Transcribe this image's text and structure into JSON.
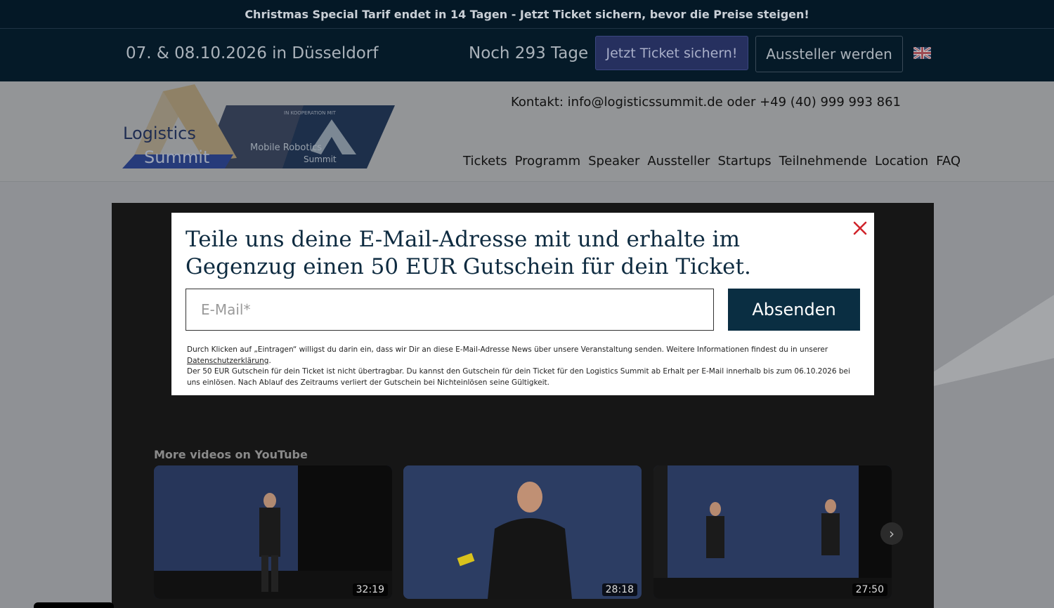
{
  "promo": {
    "text": "Christmas Special Tarif endet in 14 Tagen - Jetzt Ticket sichern, bevor die Preise steigen!"
  },
  "infobar": {
    "date": "07. & 08.10.2026 in Düsseldorf",
    "countdown": "Noch 293 Tage",
    "ticket_button": "Jetzt Ticket sichern!",
    "exhibitor_button": "Aussteller werden",
    "language_icon": "uk-flag-icon"
  },
  "header": {
    "logo": {
      "primary_line1": "Logistics",
      "primary_line2": "Summit",
      "cooperation": "IN KOOPERATION MIT",
      "partner_line1": "Mobile Robotics",
      "partner_line2": "Summit"
    },
    "contact": "Kontakt: info@logisticssummit.de oder +49 (40) 999 993 861",
    "nav": [
      "Tickets",
      "Programm",
      "Speaker",
      "Aussteller",
      "Startups",
      "Teilnehmende",
      "Location",
      "FAQ"
    ]
  },
  "video": {
    "more_label": "More videos on YouTube",
    "thumbnails": [
      {
        "duration": "32:19"
      },
      {
        "duration": "28:18"
      },
      {
        "duration": "27:50"
      }
    ],
    "next_icon": "chevron-right-icon"
  },
  "modal": {
    "title": "Teile uns deine E-Mail-Adresse mit und erhalte im Gegenzug einen 50 EUR Gutschein für dein Ticket.",
    "email_placeholder": "E-Mail*",
    "submit_label": "Absenden",
    "legal_part1": "Durch Klicken auf „Eintragen“ willigst du darin ein, dass wir Dir an diese E-Mail-Adresse News über unsere Veranstaltung senden. Weitere Informationen findest du in unserer ",
    "privacy_link": "Datenschutzerklärung",
    "legal_part2": ".",
    "legal_part3": "Der 50 EUR Gutschein für dein Ticket ist nicht übertragbar. Du kannst den Gutschein für dein Ticket für den Logistics Summit ab Erhalt per E-Mail innerhalb bis zum 06.10.2026 bei uns einlösen. Nach Ablauf des Zeitraums verliert der Gutschein bei Nichteinlösen seine Gültigkeit.",
    "close_icon": "close-icon"
  },
  "colors": {
    "dark_navy": "#051a28",
    "modal_title": "#0e2b40",
    "submit_bg": "#0a2e42",
    "close_red": "#d0242b"
  }
}
